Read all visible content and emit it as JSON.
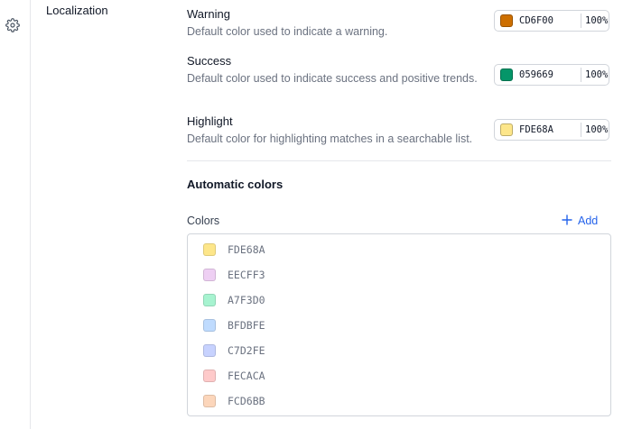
{
  "nav": {
    "settings_icon": "gear-icon",
    "section_label": "Localization"
  },
  "settings": [
    {
      "title": "Warning",
      "description": "Default color used to indicate a warning.",
      "hex": "CD6F00",
      "alpha": "100%",
      "swatch_color": "#CD6F00"
    },
    {
      "title": "Success",
      "description": "Default color used to indicate success and positive trends.",
      "hex": "059669",
      "alpha": "100%",
      "swatch_color": "#059669"
    },
    {
      "title": "Highlight",
      "description": "Default color for highlighting matches in a searchable list.",
      "hex": "FDE68A",
      "alpha": "100%",
      "swatch_color": "#FDE68A"
    }
  ],
  "automatic": {
    "title": "Automatic colors",
    "colors_label": "Colors",
    "add_label": "Add",
    "add_icon": "plus-icon",
    "accent_color": "#2563EB",
    "colors": [
      {
        "hex": "FDE68A",
        "swatch_color": "#FDE68A"
      },
      {
        "hex": "EECFF3",
        "swatch_color": "#EECFF3"
      },
      {
        "hex": "A7F3D0",
        "swatch_color": "#A7F3D0"
      },
      {
        "hex": "BFDBFE",
        "swatch_color": "#BFDBFE"
      },
      {
        "hex": "C7D2FE",
        "swatch_color": "#C7D2FE"
      },
      {
        "hex": "FECACA",
        "swatch_color": "#FECACA"
      },
      {
        "hex": "FCD6BB",
        "swatch_color": "#FCD6BB"
      }
    ]
  }
}
